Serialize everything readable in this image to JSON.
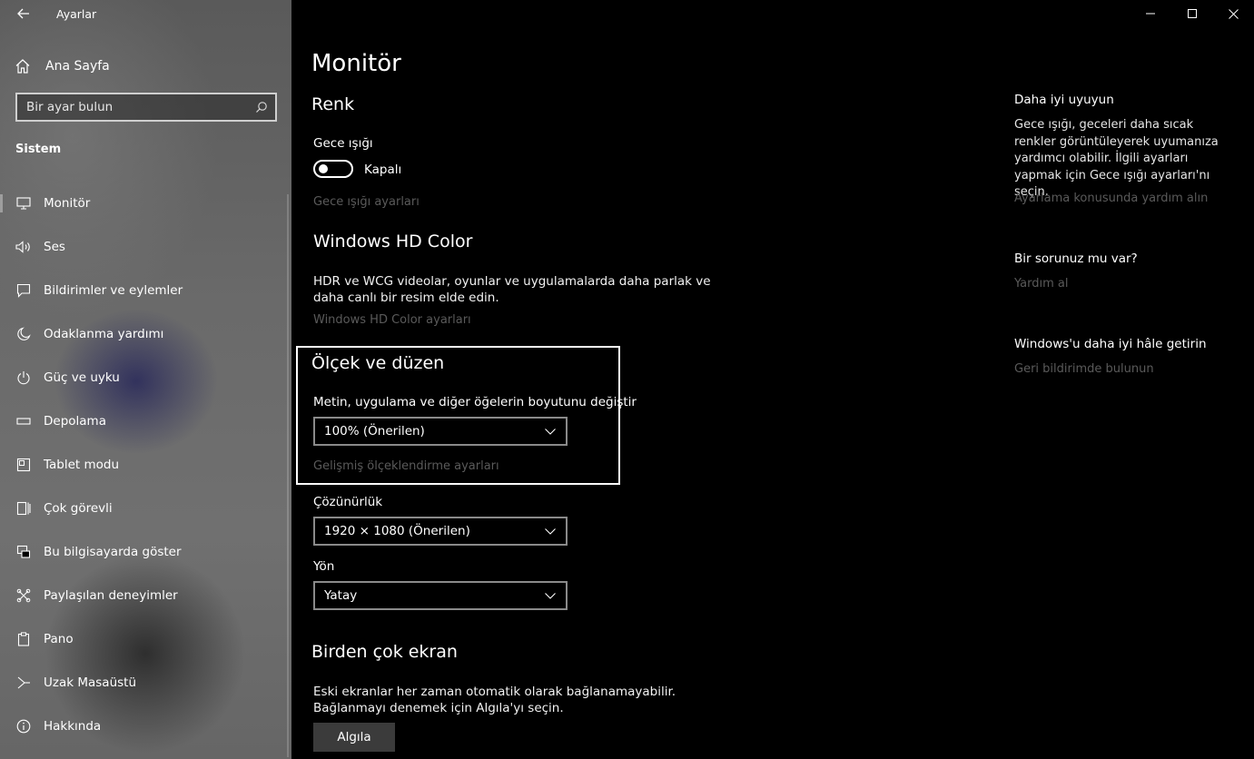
{
  "window": {
    "title": "Ayarlar",
    "controls": {
      "minimize": "minimize-icon",
      "maximize": "maximize-icon",
      "close": "close-icon"
    }
  },
  "sidebar": {
    "home_label": "Ana Sayfa",
    "search_placeholder": "Bir ayar bulun",
    "section": "Sistem",
    "items": [
      {
        "label": "Monitör",
        "icon": "monitor-icon",
        "active": true
      },
      {
        "label": "Ses",
        "icon": "speaker-icon"
      },
      {
        "label": "Bildirimler ve eylemler",
        "icon": "notification-icon"
      },
      {
        "label": "Odaklanma yardımı",
        "icon": "moon-icon"
      },
      {
        "label": "Güç ve uyku",
        "icon": "power-icon"
      },
      {
        "label": "Depolama",
        "icon": "storage-icon"
      },
      {
        "label": "Tablet modu",
        "icon": "tablet-icon"
      },
      {
        "label": "Çok görevli",
        "icon": "multitask-icon"
      },
      {
        "label": "Bu bilgisayarda göster",
        "icon": "project-icon"
      },
      {
        "label": "Paylaşılan deneyimler",
        "icon": "shared-icon"
      },
      {
        "label": "Pano",
        "icon": "clipboard-icon"
      },
      {
        "label": "Uzak Masaüstü",
        "icon": "remote-desktop-icon"
      },
      {
        "label": "Hakkında",
        "icon": "info-icon"
      }
    ]
  },
  "main": {
    "title": "Monitör",
    "color": {
      "heading": "Renk",
      "night_light_label": "Gece ışığı",
      "night_light_state": "Kapalı",
      "night_light_on": false,
      "night_light_settings": "Gece ışığı ayarları"
    },
    "hdr": {
      "heading": "Windows HD Color",
      "description": "HDR ve WCG videolar, oyunlar ve uygulamalarda daha parlak ve daha canlı bir resim elde edin.",
      "settings_link": "Windows HD Color ayarları"
    },
    "scale": {
      "heading": "Ölçek ve düzen",
      "size_label": "Metin, uygulama ve diğer öğelerin boyutunu değiştir",
      "size_value": "100% (Önerilen)",
      "advanced_link": "Gelişmiş ölçeklendirme ayarları",
      "resolution_label": "Çözünürlük",
      "resolution_value": "1920 × 1080 (Önerilen)",
      "orientation_label": "Yön",
      "orientation_value": "Yatay"
    },
    "multi": {
      "heading": "Birden çok ekran",
      "description": "Eski ekranlar her zaman otomatik olarak bağlanamayabilir. Bağlanmayı denemek için Algıla'yı seçin.",
      "detect_button": "Algıla"
    }
  },
  "aside": {
    "sleep": {
      "heading": "Daha iyi uyuyun",
      "text": "Gece ışığı, geceleri daha sıcak renkler görüntüleyerek uyumanıza yardımcı olabilir. İlgili ayarları yapmak için Gece ışığı ayarları'nı seçin.",
      "link": "Ayarlama konusunda yardım alın"
    },
    "question": {
      "heading": "Bir sorunuz mu var?",
      "link": "Yardım al"
    },
    "improve": {
      "heading": "Windows'u daha iyi hâle getirin",
      "link": "Geri bildirimde bulunun"
    }
  }
}
